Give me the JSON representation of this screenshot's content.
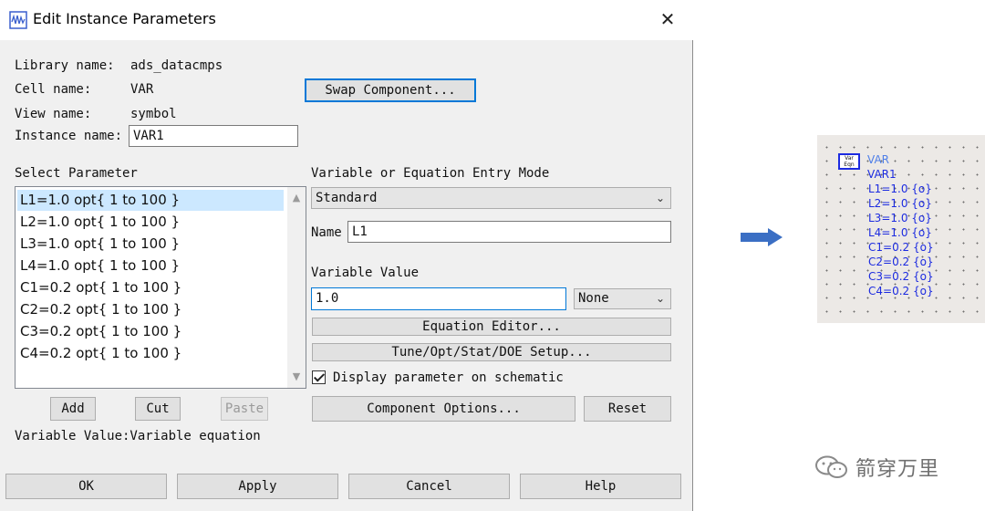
{
  "dialog": {
    "title": "Edit Instance Parameters",
    "close_glyph": "✕",
    "library_label": "Library name:",
    "library_value": "ads_datacmps",
    "cell_label": "Cell name:",
    "cell_value": "VAR",
    "view_label": "View name:",
    "view_value": "symbol",
    "instance_label": "Instance name:",
    "instance_value": "VAR1",
    "swap_button": "Swap Component...",
    "select_parameter_label": "Select Parameter",
    "parameters": [
      "L1=1.0 opt{ 1 to 100 }",
      "L2=1.0 opt{ 1 to 100 }",
      "L3=1.0 opt{ 1 to 100 }",
      "L4=1.0 opt{ 1 to 100 }",
      "C1=0.2 opt{ 1 to 100 }",
      "C2=0.2 opt{ 1 to 100 }",
      "C3=0.2 opt{ 1 to 100 }",
      "C4=0.2 opt{ 1 to 100 }"
    ],
    "selected_parameter_index": 0,
    "add_button": "Add",
    "cut_button": "Cut",
    "paste_button": "Paste",
    "status_text": "Variable Value:Variable equation",
    "entry_mode_label": "Variable or Equation Entry Mode",
    "entry_mode_value": "Standard",
    "name_label": "Name",
    "name_value": "L1",
    "variable_value_label": "Variable Value",
    "variable_value": "1.0",
    "unit_value": "None",
    "equation_editor_button": "Equation Editor...",
    "tune_button": "Tune/Opt/Stat/DOE Setup...",
    "display_checkbox_label": "Display parameter on schematic",
    "display_checked": true,
    "component_options_button": "Component Options...",
    "reset_button": "Reset",
    "ok_button": "OK",
    "apply_button": "Apply",
    "cancel_button": "Cancel",
    "help_button": "Help"
  },
  "schematic": {
    "symbol_line1": "Var",
    "symbol_line2": "Eqn",
    "component": "VAR",
    "instance": "VAR1",
    "lines": [
      "L1=1.0 {o}",
      "L2=1.0 {o}",
      "L3=1.0 {o}",
      "L4=1.0 {o}",
      "C1=0.2 {o}",
      "C2=0.2 {o}",
      "C3=0.2 {o}",
      "C4=0.2 {o}"
    ],
    "component_color": "#4f7fe8",
    "text_color": "#1c2be0"
  },
  "watermark": {
    "text": "箭穿万里"
  },
  "colors": {
    "accent": "#0078d7",
    "arrow": "#3b6fc4",
    "selection": "#cce8ff"
  }
}
